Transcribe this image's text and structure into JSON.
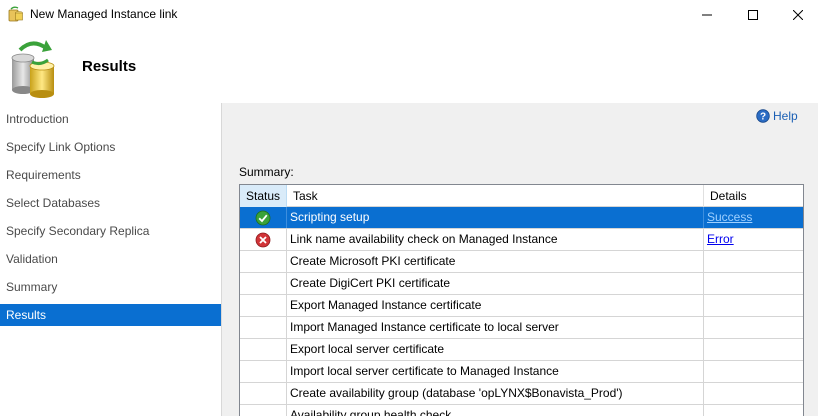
{
  "window": {
    "title": "New Managed Instance link",
    "icon": "database-wizard-icon",
    "controls": [
      "minimize",
      "maximize",
      "close"
    ]
  },
  "header": {
    "title": "Results",
    "icon": "database-sync-icon"
  },
  "sidebar": {
    "items": [
      {
        "label": "Introduction",
        "active": false
      },
      {
        "label": "Specify Link Options",
        "active": false
      },
      {
        "label": "Requirements",
        "active": false
      },
      {
        "label": "Select Databases",
        "active": false
      },
      {
        "label": "Specify Secondary Replica",
        "active": false
      },
      {
        "label": "Validation",
        "active": false
      },
      {
        "label": "Summary",
        "active": false
      },
      {
        "label": "Results",
        "active": true
      }
    ]
  },
  "main": {
    "help_label": "Help",
    "summary_label": "Summary:",
    "columns": {
      "status": "Status",
      "task": "Task",
      "details": "Details"
    },
    "rows": [
      {
        "status": "success",
        "task": "Scripting setup",
        "details": "Success",
        "selected": true
      },
      {
        "status": "error",
        "task": "Link name availability check on Managed Instance",
        "details": "Error",
        "selected": false
      },
      {
        "status": "",
        "task": "Create Microsoft PKI certificate",
        "details": "",
        "selected": false
      },
      {
        "status": "",
        "task": "Create DigiCert PKI certificate",
        "details": "",
        "selected": false
      },
      {
        "status": "",
        "task": "Export Managed Instance certificate",
        "details": "",
        "selected": false
      },
      {
        "status": "",
        "task": "Import Managed Instance certificate to local server",
        "details": "",
        "selected": false
      },
      {
        "status": "",
        "task": "Export local server certificate",
        "details": "",
        "selected": false
      },
      {
        "status": "",
        "task": "Import local server certificate to Managed Instance",
        "details": "",
        "selected": false
      },
      {
        "status": "",
        "task": "Create availability group (database 'opLYNX$Bonavista_Prod')",
        "details": "",
        "selected": false
      },
      {
        "status": "",
        "task": "Availability group health check",
        "details": "",
        "selected": false
      }
    ]
  },
  "colors": {
    "selection": "#0a6fd1",
    "link": "#0000ee",
    "success": "#3aa23a",
    "error": "#d13438",
    "panel_bg": "#f0f0f0"
  }
}
